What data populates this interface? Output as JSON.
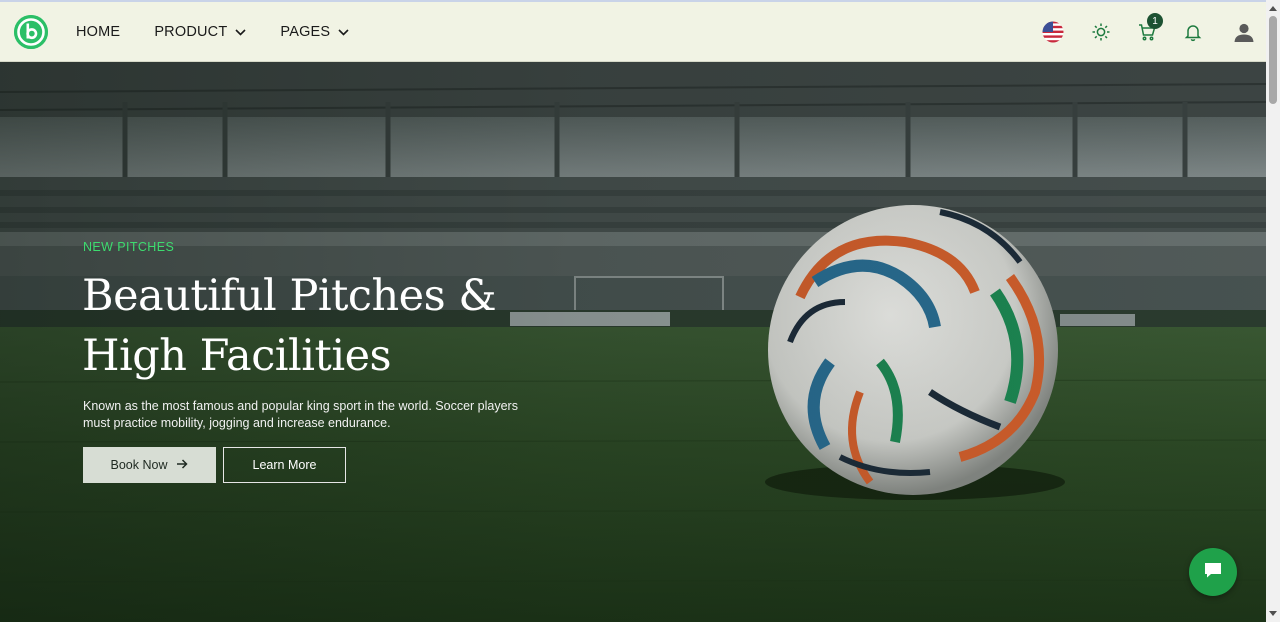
{
  "navbar": {
    "logo_icon": "brand-logo-icon",
    "items": [
      {
        "label": "HOME",
        "has_dropdown": false
      },
      {
        "label": "PRODUCT",
        "has_dropdown": true
      },
      {
        "label": "PAGES",
        "has_dropdown": true
      }
    ],
    "icons": {
      "language": "us-flag-icon",
      "theme": "sun-icon",
      "cart": "cart-icon",
      "notifications": "bell-icon",
      "account": "user-icon"
    },
    "cart_count": "1"
  },
  "hero": {
    "eyebrow": "NEW PITCHES",
    "title_line1": "Beautiful Pitches &",
    "title_line2": "High Facilities",
    "description": "Known as the most famous and popular king sport in the world. Soccer players must practice mobility, jogging and increase endurance.",
    "primary_button": "Book Now",
    "primary_button_icon": "arrow-right-icon",
    "secondary_button": "Learn More"
  },
  "chat": {
    "icon": "chat-icon"
  },
  "colors": {
    "accent": "#3ddc6f",
    "brand": "#2bbf67",
    "navbar_bg": "#f1f3e4",
    "chat_bg": "#1fa14a"
  }
}
